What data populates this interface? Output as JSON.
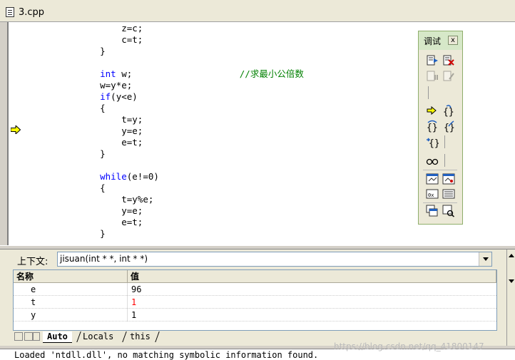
{
  "editor": {
    "tab_title": "3.cpp",
    "lines": [
      {
        "indent": "        ",
        "parts": [
          {
            "t": "z=c;",
            "c": ""
          }
        ]
      },
      {
        "indent": "        ",
        "parts": [
          {
            "t": "c=t;",
            "c": ""
          }
        ]
      },
      {
        "indent": "    ",
        "parts": [
          {
            "t": "}",
            "c": ""
          }
        ]
      },
      {
        "indent": "",
        "parts": []
      },
      {
        "indent": "    ",
        "parts": [
          {
            "t": "int",
            "c": "kw"
          },
          {
            "t": " w;",
            "c": ""
          },
          {
            "t": "                    //求最小公倍数",
            "c": "cm"
          }
        ]
      },
      {
        "indent": "    ",
        "parts": [
          {
            "t": "w=y*e;",
            "c": ""
          }
        ]
      },
      {
        "indent": "    ",
        "parts": [
          {
            "t": "if",
            "c": "kw"
          },
          {
            "t": "(y<e)",
            "c": ""
          }
        ]
      },
      {
        "indent": "    ",
        "parts": [
          {
            "t": "{",
            "c": ""
          }
        ]
      },
      {
        "indent": "        ",
        "parts": [
          {
            "t": "t=y;",
            "c": ""
          }
        ]
      },
      {
        "indent": "        ",
        "parts": [
          {
            "t": "y=e;",
            "c": ""
          }
        ]
      },
      {
        "indent": "        ",
        "parts": [
          {
            "t": "e=t;",
            "c": ""
          }
        ]
      },
      {
        "indent": "    ",
        "parts": [
          {
            "t": "}",
            "c": ""
          }
        ]
      },
      {
        "indent": "",
        "parts": []
      },
      {
        "indent": "    ",
        "parts": [
          {
            "t": "while",
            "c": "kw"
          },
          {
            "t": "(e!=0)",
            "c": ""
          }
        ]
      },
      {
        "indent": "    ",
        "parts": [
          {
            "t": "{",
            "c": ""
          }
        ]
      },
      {
        "indent": "        ",
        "parts": [
          {
            "t": "t=y%e;",
            "c": ""
          }
        ]
      },
      {
        "indent": "        ",
        "parts": [
          {
            "t": "y=e;",
            "c": ""
          }
        ]
      },
      {
        "indent": "        ",
        "parts": [
          {
            "t": "e=t;",
            "c": ""
          }
        ]
      },
      {
        "indent": "    ",
        "parts": [
          {
            "t": "}",
            "c": ""
          }
        ]
      }
    ],
    "current_line_marker": "yellow-arrow-icon"
  },
  "debug_toolbar": {
    "title": "调试",
    "close": "x"
  },
  "variables": {
    "context_label": "上下文:",
    "context_value": "jisuan(int * *, int * *)",
    "col_name": "名称",
    "col_value": "值",
    "rows": [
      {
        "name": "e",
        "value": "96",
        "changed": false
      },
      {
        "name": "t",
        "value": "1",
        "changed": true
      },
      {
        "name": "y",
        "value": "1",
        "changed": false
      }
    ],
    "tabs": [
      "Auto",
      "Locals",
      "this"
    ],
    "active_tab": "Auto"
  },
  "output": {
    "text": "Loaded 'ntdll.dll', no matching symbolic information found."
  },
  "watermark": "https://blog.csdn.net/qq_41800147",
  "colors": {
    "keyword": "#0000ff",
    "comment": "#008000",
    "changed_value": "#ff0000",
    "toolbar_border": "#8fae6b"
  }
}
